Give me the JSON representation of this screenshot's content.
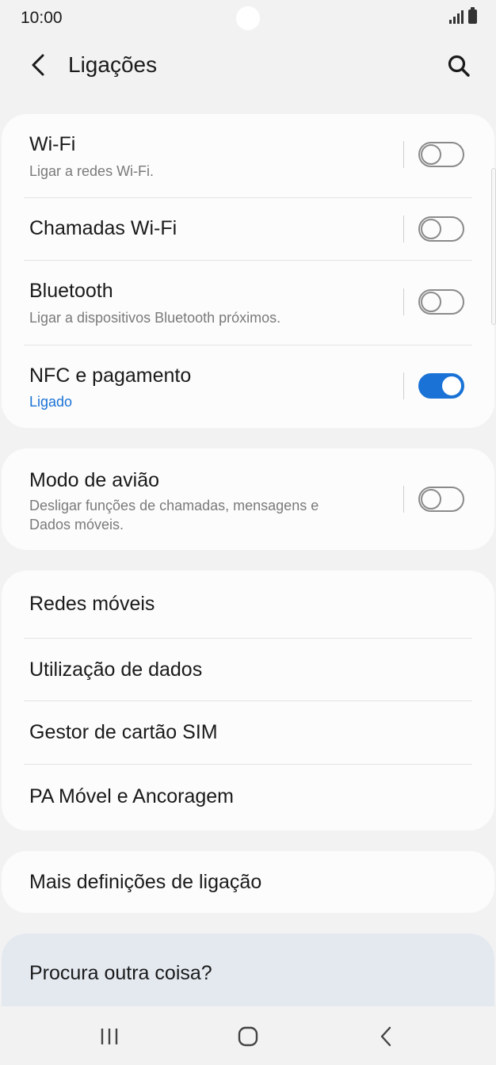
{
  "status_bar": {
    "time": "10:00"
  },
  "header": {
    "title": "Ligações"
  },
  "connections": {
    "wifi": {
      "title": "Wi-Fi",
      "subtitle": "Ligar a redes Wi-Fi.",
      "enabled": false
    },
    "wifi_calling": {
      "title": "Chamadas Wi-Fi",
      "enabled": false
    },
    "bluetooth": {
      "title": "Bluetooth",
      "subtitle": "Ligar a dispositivos Bluetooth próximos.",
      "enabled": false
    },
    "nfc": {
      "title": "NFC e pagamento",
      "subtitle": "Ligado",
      "enabled": true
    }
  },
  "airplane": {
    "title": "Modo de avião",
    "subtitle_line1": "Desligar funções de chamadas, mensagens e",
    "subtitle_line2": "Dados móveis.",
    "enabled": false
  },
  "network_menu": {
    "items": [
      {
        "label": "Redes móveis"
      },
      {
        "label": "Utilização de dados"
      },
      {
        "label": "Gestor de cartão SIM"
      },
      {
        "label": "PA Móvel e Ancoragem"
      }
    ]
  },
  "more_settings": {
    "label": "Mais definições de ligação"
  },
  "suggestion": {
    "label": "Procura outra coisa?"
  },
  "colors": {
    "accent": "#1a72d6",
    "background": "#f2f2f2",
    "card": "#fcfcfc"
  }
}
